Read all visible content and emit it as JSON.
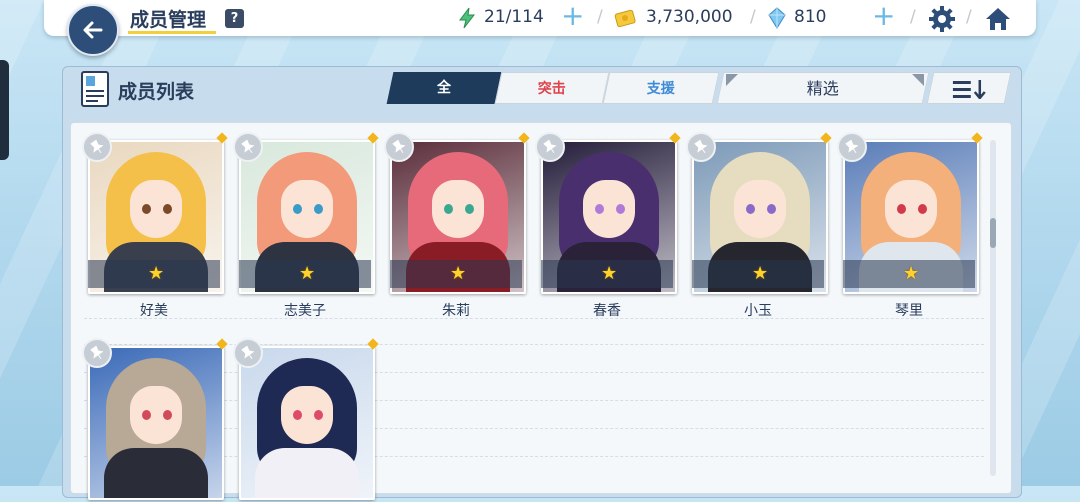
{
  "header": {
    "title": "成员管理",
    "help_label": "?",
    "ap": "21/114",
    "credits": "3,730,000",
    "gems": "810",
    "separator": "/"
  },
  "panel": {
    "title": "成员列表",
    "tabs": [
      {
        "label": "全",
        "selected": true
      },
      {
        "label": "突击"
      },
      {
        "label": "支援"
      }
    ],
    "filter_label": "精选"
  },
  "students": [
    {
      "name": "好美",
      "stars": 1,
      "hair": "#f4c04a",
      "eyes": "#7a4a2a",
      "outfit": "#3a3f4e",
      "bg": "#e9d8c0"
    },
    {
      "name": "志美子",
      "stars": 1,
      "hair": "#f29a7a",
      "eyes": "#3a9ac8",
      "outfit": "#2d3340",
      "bg": "#d8e8dc"
    },
    {
      "name": "朱莉",
      "stars": 1,
      "hair": "#e76a7a",
      "eyes": "#3aa890",
      "outfit": "#8a1c25",
      "bg": "#5a2d3a"
    },
    {
      "name": "春香",
      "stars": 1,
      "hair": "#4a2f6e",
      "eyes": "#b07ad8",
      "outfit": "#2a2238",
      "bg": "#241c3a"
    },
    {
      "name": "小玉",
      "stars": 1,
      "hair": "#e6dcc0",
      "eyes": "#8a6ac8",
      "outfit": "#25262e",
      "bg": "#7d9ab8"
    },
    {
      "name": "琴里",
      "stars": 1,
      "hair": "#f3b07a",
      "eyes": "#d23a4a",
      "outfit": "#dfe6ee",
      "bg": "#5a7db8"
    },
    {
      "name": "",
      "stars": 0,
      "hair": "#b8a896",
      "eyes": "#d24a5a",
      "outfit": "#2a2d38",
      "bg": "#3a6ab8"
    },
    {
      "name": "",
      "stars": 0,
      "hair": "#1e2a54",
      "eyes": "#e04a6a",
      "outfit": "#f0f0f6",
      "bg": "#c8d8ec"
    }
  ],
  "colors": {
    "accent": "#1f3b5c",
    "striker": "#e0424a",
    "special": "#3d8ad6",
    "star": "#ffd12c"
  }
}
